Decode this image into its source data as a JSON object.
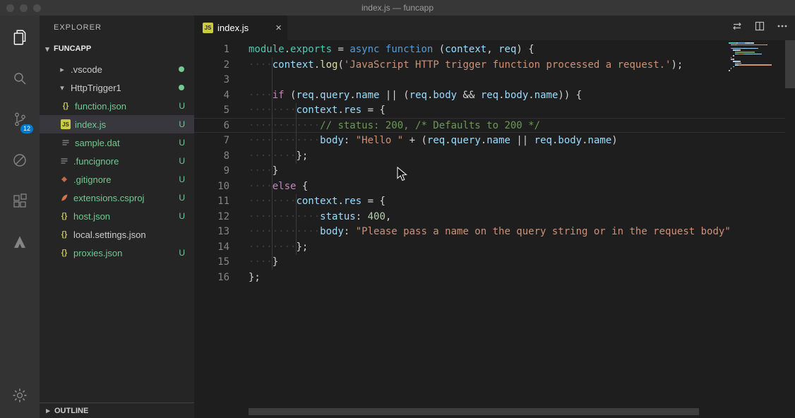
{
  "window": {
    "title": "index.js — funcapp"
  },
  "activity_bar": {
    "scm_badge": "12"
  },
  "icons": {
    "js_label": "JS"
  },
  "sidebar": {
    "title": "EXPLORER",
    "section": "FUNCAPP",
    "outline": "OUTLINE",
    "files": [
      {
        "label": ".vscode",
        "type": "folder",
        "expanded": false,
        "depth": 0,
        "dot": true,
        "badge": "",
        "status": "normal"
      },
      {
        "label": "HttpTrigger1",
        "type": "folder",
        "expanded": true,
        "depth": 0,
        "dot": true,
        "badge": "",
        "status": "normal"
      },
      {
        "label": "function.json",
        "type": "file",
        "icon": "json",
        "depth": 1,
        "badge": "U",
        "status": "untracked"
      },
      {
        "label": "index.js",
        "type": "file",
        "icon": "js",
        "depth": 1,
        "badge": "U",
        "status": "untracked",
        "selected": true
      },
      {
        "label": "sample.dat",
        "type": "file",
        "icon": "lines",
        "depth": 1,
        "badge": "U",
        "status": "untracked"
      },
      {
        "label": ".funcignore",
        "type": "file",
        "icon": "lines",
        "depth": 0,
        "badge": "U",
        "status": "untracked"
      },
      {
        "label": ".gitignore",
        "type": "file",
        "icon": "git",
        "depth": 0,
        "badge": "U",
        "status": "untracked"
      },
      {
        "label": "extensions.csproj",
        "type": "file",
        "icon": "csproj",
        "depth": 0,
        "badge": "U",
        "status": "untracked"
      },
      {
        "label": "host.json",
        "type": "file",
        "icon": "json",
        "depth": 0,
        "badge": "U",
        "status": "untracked"
      },
      {
        "label": "local.settings.json",
        "type": "file",
        "icon": "json",
        "depth": 0,
        "badge": "",
        "status": "normal"
      },
      {
        "label": "proxies.json",
        "type": "file",
        "icon": "json",
        "depth": 0,
        "badge": "U",
        "status": "untracked"
      }
    ]
  },
  "editor": {
    "tab": {
      "label": "index.js"
    },
    "code": {
      "active_line": 6,
      "lines": [
        [
          [
            "mod",
            "module"
          ],
          [
            "pun",
            "."
          ],
          [
            "mod",
            "exports"
          ],
          [
            "pun",
            " = "
          ],
          [
            "kw2",
            "async"
          ],
          [
            "pun",
            " "
          ],
          [
            "kw2",
            "function"
          ],
          [
            "pun",
            " ("
          ],
          [
            "var",
            "context"
          ],
          [
            "pun",
            ", "
          ],
          [
            "var",
            "req"
          ],
          [
            "pun",
            ") {"
          ]
        ],
        [
          [
            "ws",
            "····"
          ],
          [
            "var",
            "context"
          ],
          [
            "pun",
            "."
          ],
          [
            "fn",
            "log"
          ],
          [
            "pun",
            "("
          ],
          [
            "str",
            "'JavaScript HTTP trigger function processed a request.'"
          ],
          [
            "pun",
            ");"
          ]
        ],
        [],
        [
          [
            "ws",
            "····"
          ],
          [
            "kw",
            "if"
          ],
          [
            "pun",
            " ("
          ],
          [
            "var",
            "req"
          ],
          [
            "pun",
            "."
          ],
          [
            "var",
            "query"
          ],
          [
            "pun",
            "."
          ],
          [
            "var",
            "name"
          ],
          [
            "pun",
            " || ("
          ],
          [
            "var",
            "req"
          ],
          [
            "pun",
            "."
          ],
          [
            "var",
            "body"
          ],
          [
            "pun",
            " && "
          ],
          [
            "var",
            "req"
          ],
          [
            "pun",
            "."
          ],
          [
            "var",
            "body"
          ],
          [
            "pun",
            "."
          ],
          [
            "var",
            "name"
          ],
          [
            "pun",
            ")) {"
          ]
        ],
        [
          [
            "ws",
            "········"
          ],
          [
            "var",
            "context"
          ],
          [
            "pun",
            "."
          ],
          [
            "var",
            "res"
          ],
          [
            "pun",
            " = {"
          ]
        ],
        [
          [
            "ws",
            "············"
          ],
          [
            "com",
            "// status: 200, /* Defaults to 200 */"
          ]
        ],
        [
          [
            "ws",
            "············"
          ],
          [
            "var",
            "body"
          ],
          [
            "pun",
            ": "
          ],
          [
            "str",
            "\"Hello \""
          ],
          [
            "pun",
            " + ("
          ],
          [
            "var",
            "req"
          ],
          [
            "pun",
            "."
          ],
          [
            "var",
            "query"
          ],
          [
            "pun",
            "."
          ],
          [
            "var",
            "name"
          ],
          [
            "pun",
            " || "
          ],
          [
            "var",
            "req"
          ],
          [
            "pun",
            "."
          ],
          [
            "var",
            "body"
          ],
          [
            "pun",
            "."
          ],
          [
            "var",
            "name"
          ],
          [
            "pun",
            ")"
          ]
        ],
        [
          [
            "ws",
            "········"
          ],
          [
            "pun",
            "};"
          ]
        ],
        [
          [
            "ws",
            "····"
          ],
          [
            "pun",
            "}"
          ]
        ],
        [
          [
            "ws",
            "····"
          ],
          [
            "kw",
            "else"
          ],
          [
            "pun",
            " {"
          ]
        ],
        [
          [
            "ws",
            "········"
          ],
          [
            "var",
            "context"
          ],
          [
            "pun",
            "."
          ],
          [
            "var",
            "res"
          ],
          [
            "pun",
            " = {"
          ]
        ],
        [
          [
            "ws",
            "············"
          ],
          [
            "var",
            "status"
          ],
          [
            "pun",
            ": "
          ],
          [
            "num",
            "400"
          ],
          [
            "pun",
            ","
          ]
        ],
        [
          [
            "ws",
            "············"
          ],
          [
            "var",
            "body"
          ],
          [
            "pun",
            ": "
          ],
          [
            "str",
            "\"Please pass a name on the query string or in the request body\""
          ]
        ],
        [
          [
            "ws",
            "········"
          ],
          [
            "pun",
            "};"
          ]
        ],
        [
          [
            "ws",
            "····"
          ],
          [
            "pun",
            "}"
          ]
        ],
        [
          [
            "pun",
            "};"
          ]
        ]
      ]
    }
  },
  "colors": {
    "accent": "#007acc",
    "untracked_green": "#73c991",
    "editor_bg": "#1e1e1e",
    "activity_bar_bg": "#333333",
    "sidebar_bg": "#252526"
  }
}
